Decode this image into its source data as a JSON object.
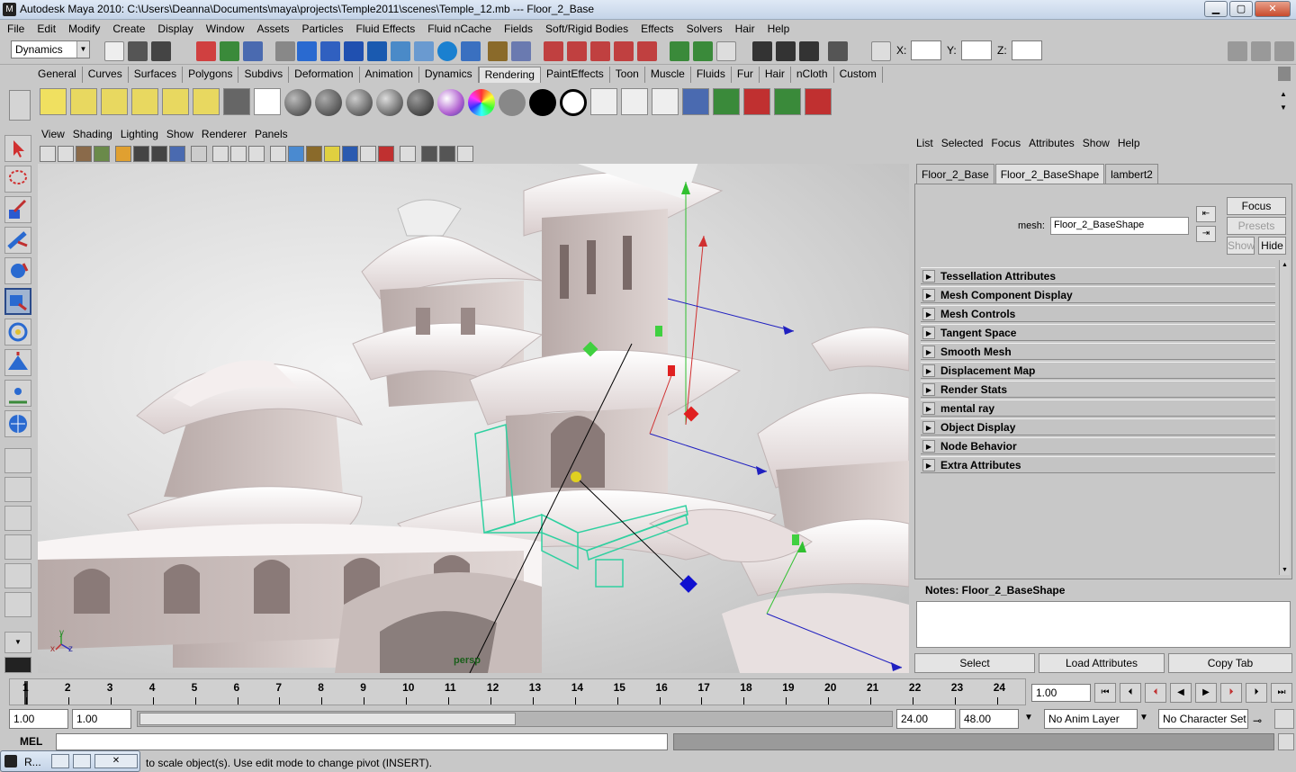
{
  "window": {
    "title": "Autodesk Maya 2010: C:\\Users\\Deanna\\Documents\\maya\\projects\\Temple2011\\scenes\\Temple_12.mb   ---   Floor_2_Base",
    "minimize": "▁",
    "maximize": "▢",
    "close": "✕"
  },
  "menubar": [
    "File",
    "Edit",
    "Modify",
    "Create",
    "Display",
    "Window",
    "Assets",
    "Particles",
    "Fluid Effects",
    "Fluid nCache",
    "Fields",
    "Soft/Rigid Bodies",
    "Effects",
    "Solvers",
    "Hair",
    "Help"
  ],
  "statusline": {
    "menuset": "Dynamics",
    "x_label": "X:",
    "y_label": "Y:",
    "z_label": "Z:"
  },
  "shelf_tabs": [
    "General",
    "Curves",
    "Surfaces",
    "Polygons",
    "Subdivs",
    "Deformation",
    "Animation",
    "Dynamics",
    "Rendering",
    "PaintEffects",
    "Toon",
    "Muscle",
    "Fluids",
    "Fur",
    "Hair",
    "nCloth",
    "Custom"
  ],
  "shelf_active_tab": "Rendering",
  "viewport": {
    "menu": [
      "View",
      "Shading",
      "Lighting",
      "Show",
      "Renderer",
      "Panels"
    ],
    "camera_label": "persp",
    "axis_y": "y",
    "axis_z": "z",
    "axis_x": "x"
  },
  "attribute_editor": {
    "menu": [
      "List",
      "Selected",
      "Focus",
      "Attributes",
      "Show",
      "Help"
    ],
    "tabs": [
      "Floor_2_Base",
      "Floor_2_BaseShape",
      "lambert2"
    ],
    "active_tab": "Floor_2_BaseShape",
    "mesh_label": "mesh:",
    "mesh_value": "Floor_2_BaseShape",
    "focus_button": "Focus",
    "presets_button": "Presets",
    "show_button": "Show",
    "hide_button": "Hide",
    "sections": [
      "Tessellation Attributes",
      "Mesh Component Display",
      "Mesh Controls",
      "Tangent Space",
      "Smooth Mesh",
      "Displacement Map",
      "Render Stats",
      "mental ray",
      "Object Display",
      "Node Behavior",
      "Extra Attributes"
    ],
    "notes_label": "Notes:  Floor_2_BaseShape",
    "footer": {
      "select": "Select",
      "load_attributes": "Load Attributes",
      "copy_tab": "Copy Tab"
    }
  },
  "timeslider": {
    "ticks": [
      "1",
      "2",
      "3",
      "4",
      "5",
      "6",
      "7",
      "8",
      "9",
      "10",
      "11",
      "12",
      "13",
      "14",
      "15",
      "16",
      "17",
      "18",
      "19",
      "20",
      "21",
      "22",
      "23",
      "24"
    ],
    "current_time": "1.00"
  },
  "rangeslider": {
    "start_time": "1.00",
    "playback_start": "1.00",
    "playback_end": "24.00",
    "end_time": "48.00",
    "anim_layer": "No Anim Layer",
    "character_set": "No Character Set"
  },
  "cmdline": {
    "label": "MEL"
  },
  "helpline": {
    "text": "to scale object(s). Use edit mode to change pivot (INSERT).",
    "mini_window_title": "R..."
  }
}
